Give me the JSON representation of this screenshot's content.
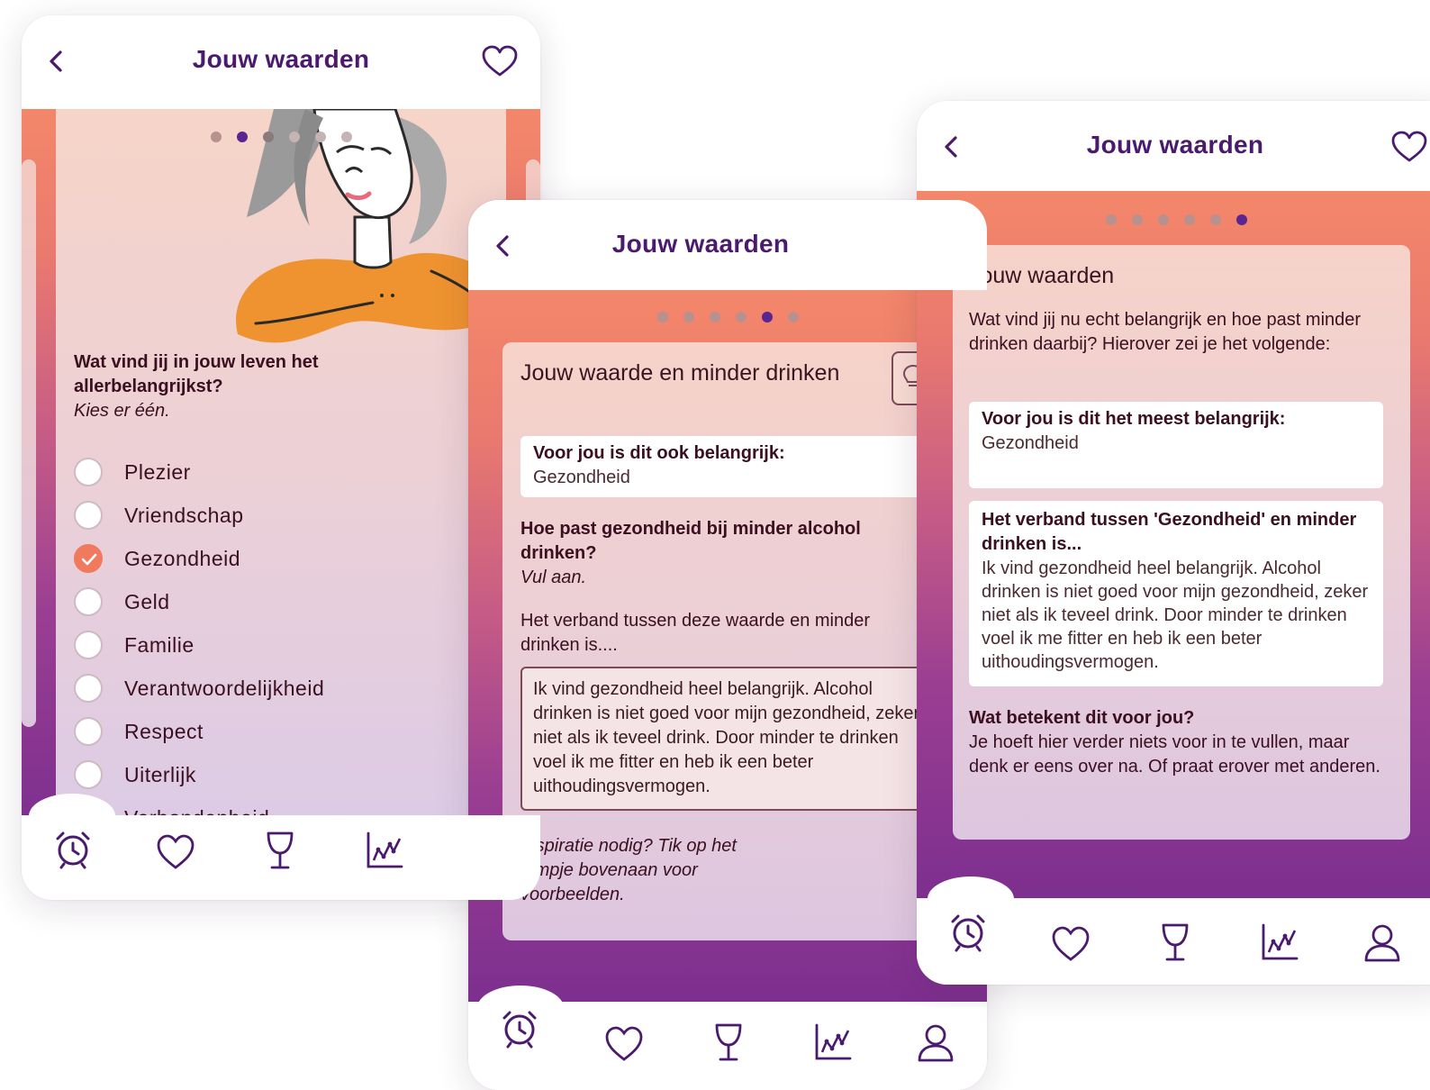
{
  "screen1": {
    "title": "Jouw waarden",
    "progress": {
      "total": 6,
      "current": 2
    },
    "question": "Wat vind jij in jouw leven het allerbelangrijkst?",
    "hint": "Kies er één.",
    "options": [
      {
        "label": "Plezier",
        "checked": false
      },
      {
        "label": "Vriendschap",
        "checked": false
      },
      {
        "label": "Gezondheid",
        "checked": true
      },
      {
        "label": "Geld",
        "checked": false
      },
      {
        "label": "Familie",
        "checked": false
      },
      {
        "label": "Verantwoordelijkheid",
        "checked": false
      },
      {
        "label": "Respect",
        "checked": false
      },
      {
        "label": "Uiterlijk",
        "checked": false
      },
      {
        "label": "Verbondenheid",
        "checked": false
      }
    ]
  },
  "screen2": {
    "title": "Jouw waarden",
    "progress": {
      "total": 6,
      "current": 5
    },
    "card_title": "Jouw waarde en minder drinken",
    "important_label": "Voor jou is dit ook belangrijk:",
    "important_value": "Gezondheid",
    "question": "Hoe past gezondheid bij minder alcohol drinken?",
    "hint": "Vul aan.",
    "prompt": "Het verband tussen deze waarde en minder drinken is....",
    "answer": "Ik vind gezondheid heel belangrijk. Alcohol drinken is niet goed voor mijn gezondheid, zeker niet als ik teveel drink. Door minder te drinken voel ik me fitter en heb ik een beter uithoudingsvermogen.",
    "inspiration": "Inspiratie nodig? Tik op het lampje bovenaan voor voorbeelden."
  },
  "screen3": {
    "title": "Jouw waarden",
    "progress": {
      "total": 6,
      "current": 6
    },
    "card_title": "Jouw waarden",
    "intro": "Wat vind jij nu echt belangrijk en hoe past minder drinken daarbij? Hierover zei je het volgende:",
    "most_important_label": "Voor jou is dit het meest belangrijk:",
    "most_important_value": "Gezondheid",
    "link_label": "Het verband tussen 'Gezondheid' en minder drinken is...",
    "link_value": "Ik vind gezondheid heel belangrijk. Alcohol drinken is niet goed voor mijn gezondheid, zeker niet als ik teveel drink. Door minder te drinken voel ik me fitter en heb ik een beter uithoudingsvermogen.",
    "meaning_label": "Wat betekent dit voor jou?",
    "meaning_value": "Je hoeft hier verder niets voor in te vullen, maar denk er eens over na. Of praat erover met anderen."
  },
  "nav": [
    "alarm-clock-icon",
    "heart-icon",
    "wine-glass-icon",
    "chart-icon",
    "user-icon"
  ],
  "colors": {
    "accent": "#4a1a6e",
    "orange": "#f3876a",
    "purple": "#7d2f8f",
    "checked": "#f07a5e"
  }
}
